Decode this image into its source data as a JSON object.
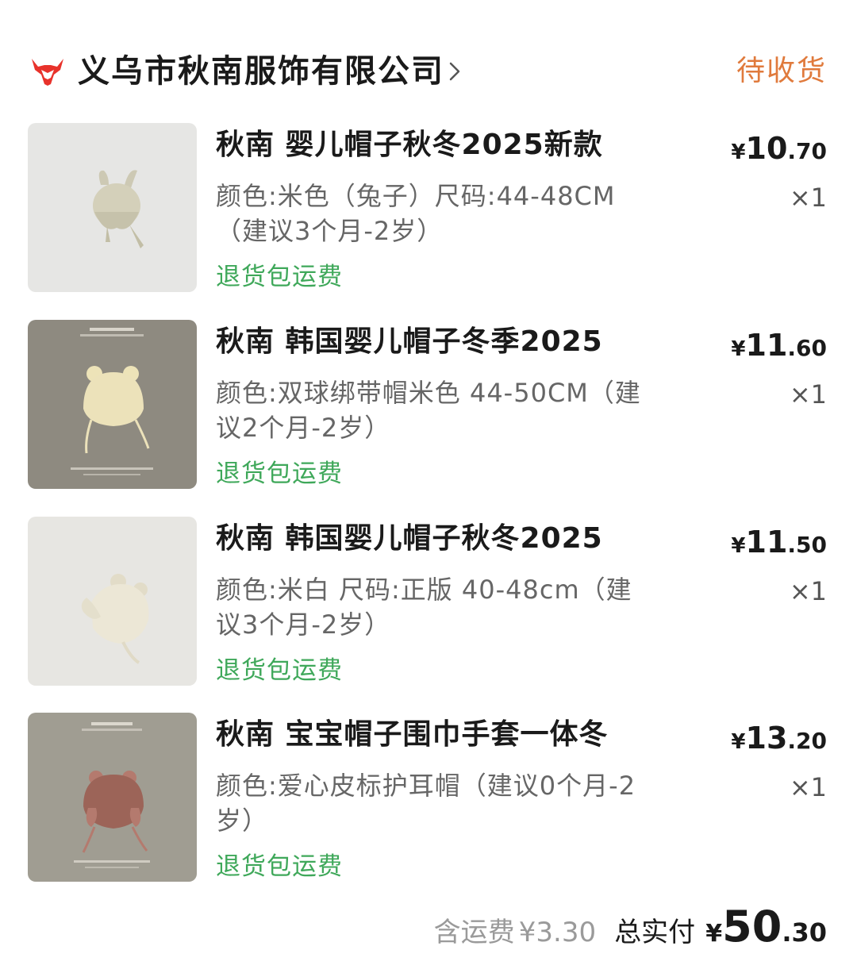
{
  "header": {
    "store_name": "义乌市秋南服饰有限公司",
    "status": "待收货",
    "logo_icon": "bull-head-icon",
    "accent_color": "#e8322b"
  },
  "items": [
    {
      "title": "秋南 婴儿帽子秋冬2025新款",
      "spec": "颜色:米色（兔子）尺码:44-48CM（建议3个月-2岁）",
      "return_tag": "退货包运费",
      "price_symbol": "¥",
      "price_int": "10",
      "price_dec": ".70",
      "qty": "×1"
    },
    {
      "title": "秋南 韩国婴儿帽子冬季2025",
      "spec": "颜色:双球绑带帽米色 44-50CM（建议2个月-2岁）",
      "return_tag": "退货包运费",
      "price_symbol": "¥",
      "price_int": "11",
      "price_dec": ".60",
      "qty": "×1"
    },
    {
      "title": "秋南 韩国婴儿帽子秋冬2025",
      "spec": "颜色:米白 尺码:正版 40-48cm（建议3个月-2岁）",
      "return_tag": "退货包运费",
      "price_symbol": "¥",
      "price_int": "11",
      "price_dec": ".50",
      "qty": "×1"
    },
    {
      "title": "秋南 宝宝帽子围巾手套一体冬",
      "spec": "颜色:爱心皮标护耳帽（建议0个月-2岁）",
      "return_tag": "退货包运费",
      "price_symbol": "¥",
      "price_int": "13",
      "price_dec": ".20",
      "qty": "×1"
    }
  ],
  "footer": {
    "shipping_label": "含运费",
    "shipping_value": "¥3.30",
    "total_label": "总实付",
    "total_symbol": "¥",
    "total_int": "50",
    "total_dec": ".30"
  },
  "colors": {
    "status": "#e07a3c",
    "return_tag": "#3fa85a",
    "text_primary": "#1a1a1a",
    "text_secondary": "#666666"
  }
}
